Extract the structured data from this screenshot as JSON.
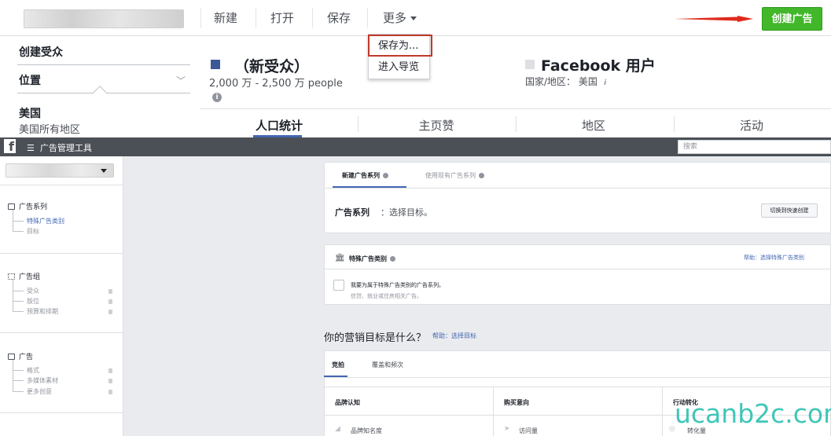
{
  "top_toolbar": {
    "new": "新建",
    "open": "打开",
    "save": "保存",
    "more": "更多",
    "create_ad": "创建广告"
  },
  "more_menu": {
    "save_as": "保存为...",
    "export_browse": "进入导览"
  },
  "audience_panel": {
    "title": "创建受众",
    "location_label": "位置",
    "country": "美国",
    "all_areas": "美国所有地区"
  },
  "audience": {
    "name": "（新受众）",
    "size": "2,000 万 - 2,500 万 people",
    "fb_users": "Facebook 用户",
    "country_line": "国家/地区： 美国"
  },
  "insight_tabs": [
    "人口统计",
    "主页赞",
    "地区",
    "活动"
  ],
  "ads_manager": {
    "app_title": "广告管理工具",
    "search_placeholder": "搜索"
  },
  "sidebar": {
    "campaign": "广告系列",
    "campaign_items": [
      "特殊广告类别",
      "目标"
    ],
    "adset": "广告组",
    "adset_items": [
      "受众",
      "版位",
      "预算和排期"
    ],
    "ad": "广告",
    "ad_items": [
      "格式",
      "多媒体素材",
      "更多创意"
    ]
  },
  "campaign_card": {
    "tab_new": "新建广告系列",
    "tab_existing": "使用现有广告系列",
    "label": "广告系列",
    "text": "：选择目标。",
    "quick_button": "切换到快速创建"
  },
  "special_card": {
    "title": "特殊广告类别",
    "help": "帮助：选择特殊广告类别",
    "checkbox_text": "我要为属于特殊广告类别的广告系列。",
    "checkbox_sub": "信贷、就业或住房相关广告。"
  },
  "objective": {
    "question": "你的营销目标是什么？",
    "help": "帮助：选择目标",
    "tabs": [
      "竞拍",
      "覆盖和频次"
    ],
    "columns": [
      "品牌认知",
      "购买意向",
      "行动转化"
    ],
    "items": [
      "品牌知名度",
      "访问量",
      "转化量"
    ]
  },
  "watermark": "ucanb2c.com",
  "colors": {
    "create_button": "#42b72a",
    "highlight_box": "#c0392b",
    "arrow": "#e02a1c",
    "link": "#4267b2",
    "topbar": "#4b4f56"
  }
}
